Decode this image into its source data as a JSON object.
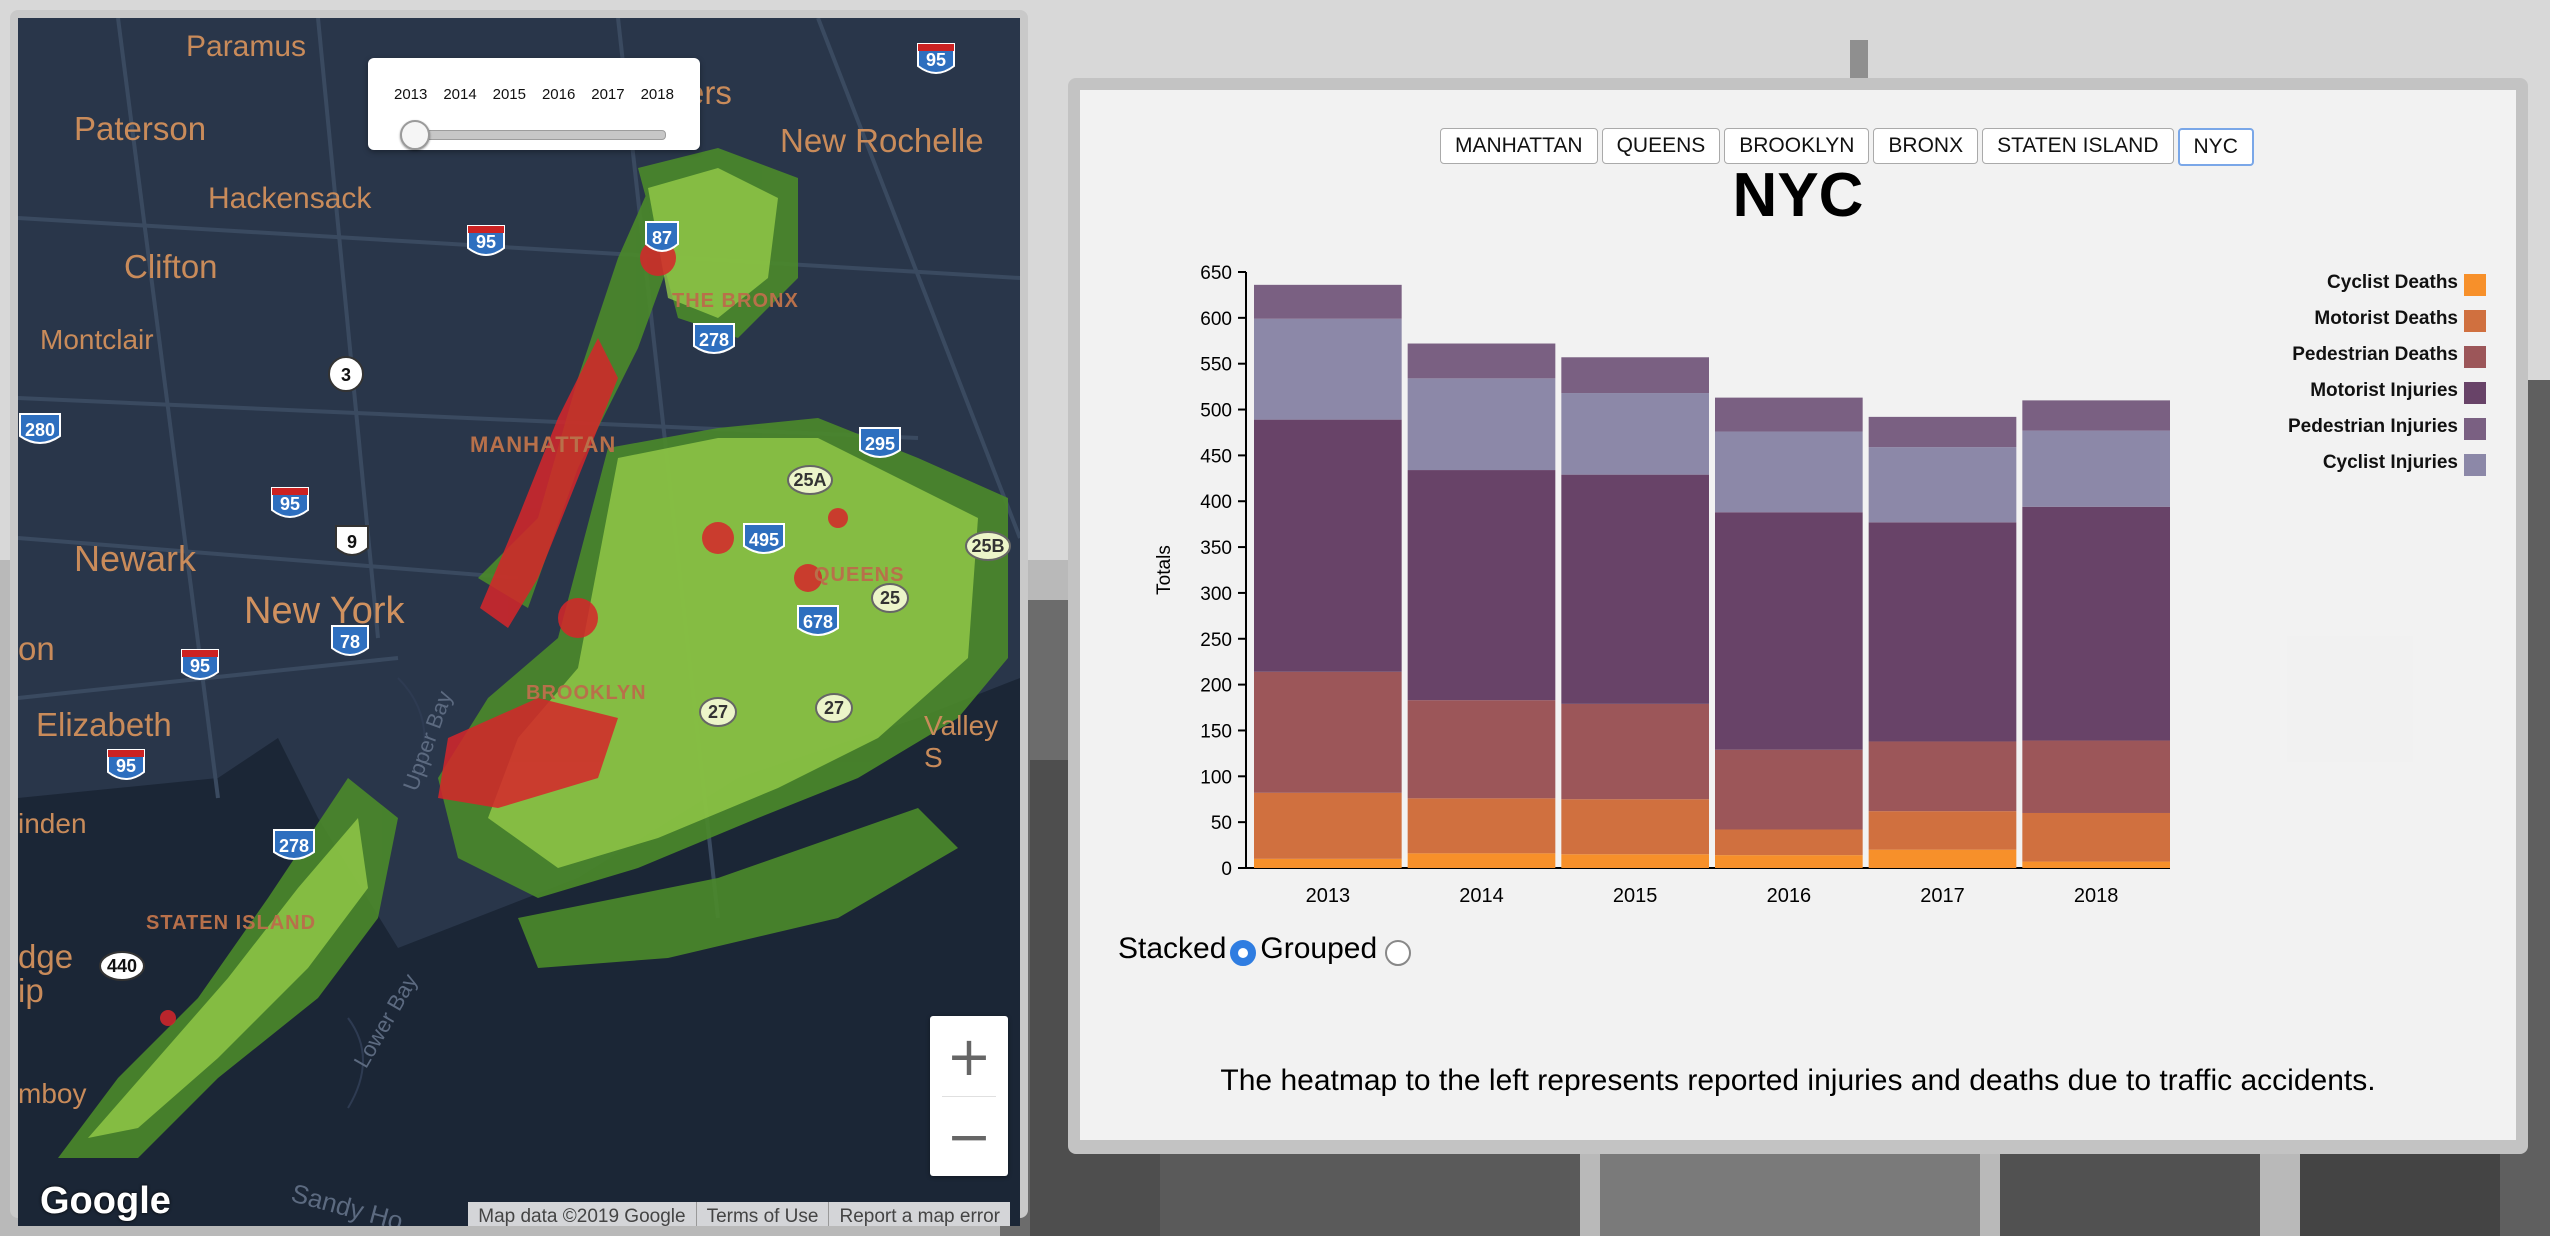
{
  "map": {
    "years": [
      "2013",
      "2014",
      "2015",
      "2016",
      "2017",
      "2018"
    ],
    "selected_year": "2013",
    "labels": [
      {
        "text": "Paramus",
        "cls": "city"
      },
      {
        "text": "Paterson",
        "cls": "city"
      },
      {
        "text": "Hackensack",
        "cls": "city"
      },
      {
        "text": "Clifton",
        "cls": "city"
      },
      {
        "text": "Montclair",
        "cls": "city"
      },
      {
        "text": "Newark",
        "cls": "city"
      },
      {
        "text": "New York",
        "cls": "city"
      },
      {
        "text": "Elizabeth",
        "cls": "city"
      },
      {
        "text": "New Rochelle",
        "cls": "city"
      },
      {
        "text": "MANHATTAN",
        "cls": "area"
      },
      {
        "text": "THE BRONX",
        "cls": "area"
      },
      {
        "text": "QUEENS",
        "cls": "area"
      },
      {
        "text": "BROOKLYN",
        "cls": "area"
      },
      {
        "text": "STATEN ISLAND",
        "cls": "area"
      },
      {
        "text": "Upper Bay",
        "cls": "water"
      },
      {
        "text": "Lower Bay",
        "cls": "water"
      },
      {
        "text": "Sandy Ho",
        "cls": "water"
      },
      {
        "text": "Valley S",
        "cls": "city"
      },
      {
        "text": "on",
        "cls": "city"
      },
      {
        "text": "inden",
        "cls": "city"
      },
      {
        "text": "dge",
        "cls": "city"
      },
      {
        "text": "ip",
        "cls": "city"
      },
      {
        "text": "mboy",
        "cls": "city"
      },
      {
        "text": "ers",
        "cls": "city"
      }
    ],
    "shields": [
      "95",
      "95",
      "95",
      "95",
      "95",
      "278",
      "278",
      "295",
      "495",
      "678",
      "280",
      "87",
      "3",
      "9",
      "78",
      "440",
      "25",
      "25A",
      "25B",
      "27",
      "27"
    ],
    "zoom_in": "+",
    "zoom_out": "−",
    "google": "Google",
    "attribution": [
      "Map data ©2019 Google",
      "Terms of Use",
      "Report a map error"
    ]
  },
  "boroughs": [
    "MANHATTAN",
    "QUEENS",
    "BROOKLYN",
    "BRONX",
    "STATEN ISLAND",
    "NYC"
  ],
  "active_borough": "NYC",
  "mode": {
    "stacked": "Stacked",
    "grouped": "Grouped",
    "selected": "stacked"
  },
  "caption": "The heatmap to the left represents reported injuries and deaths due to traffic accidents.",
  "chart_data": {
    "type": "bar",
    "title": "NYC",
    "ylabel": "Totals",
    "xlabel": "",
    "stacked": true,
    "categories": [
      "2013",
      "2014",
      "2015",
      "2016",
      "2017",
      "2018"
    ],
    "ylim": [
      0,
      650
    ],
    "yticks": [
      0,
      50,
      100,
      150,
      200,
      250,
      300,
      350,
      400,
      450,
      500,
      550,
      600,
      650
    ],
    "legend_position": "top-right",
    "series": [
      {
        "name": "Cyclist Deaths",
        "color": "#f7902a",
        "values": [
          10,
          16,
          15,
          14,
          20,
          7
        ]
      },
      {
        "name": "Motorist Deaths",
        "color": "#d0703f",
        "values": [
          72,
          60,
          60,
          28,
          42,
          53
        ]
      },
      {
        "name": "Pedestrian Deaths",
        "color": "#9c5659",
        "values": [
          132,
          107,
          104,
          87,
          76,
          79
        ]
      },
      {
        "name": "Motorist Injuries",
        "color": "#684368",
        "values": [
          275,
          251,
          250,
          259,
          239,
          255
        ]
      },
      {
        "name": "Pedestrian Injuries",
        "color": "#826b8c",
        "values": [
          0,
          0,
          0,
          0,
          0,
          0
        ]
      },
      {
        "name": "Cyclist Injuries",
        "color": "#8c88a8",
        "values": [
          110,
          100,
          89,
          88,
          82,
          83
        ]
      }
    ],
    "top_band": {
      "name": "Pedestrian Injuries",
      "color": "#7a6082",
      "values": [
        37,
        38,
        39,
        37,
        33,
        33
      ]
    }
  }
}
